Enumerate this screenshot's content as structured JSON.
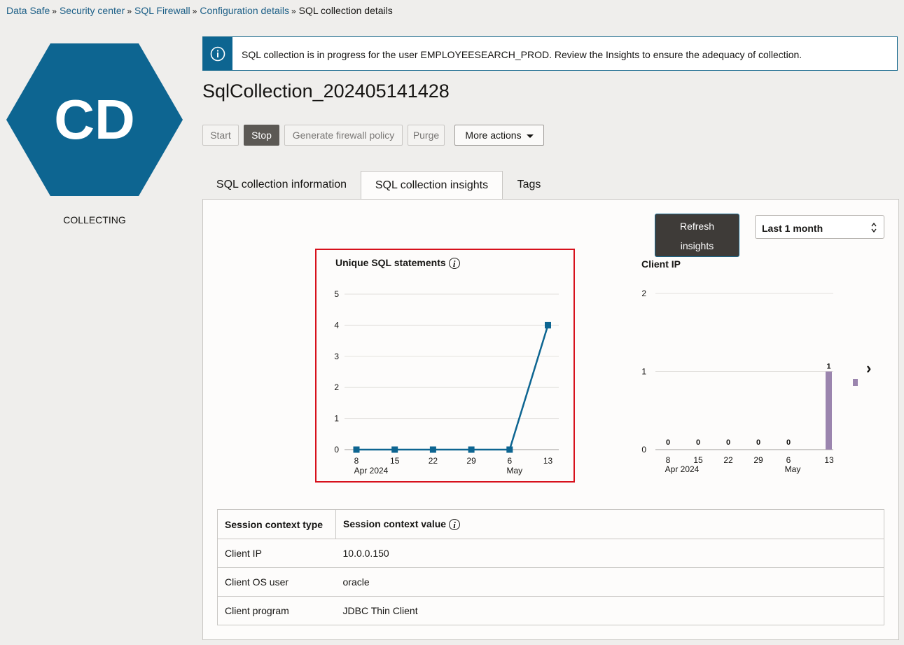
{
  "breadcrumb": {
    "items": [
      "Data Safe",
      "Security center",
      "SQL Firewall",
      "Configuration details"
    ],
    "separator": "»",
    "current": "SQL collection details"
  },
  "badge": {
    "initials": "CD",
    "status": "COLLECTING",
    "color": "#0d6591"
  },
  "banner": {
    "icon": "info-circle-icon",
    "message": "SQL collection is in progress for the user EMPLOYEESEARCH_PROD. Review the Insights to ensure the adequacy of collection."
  },
  "title": "SqlCollection_202405141428",
  "toolbar": {
    "start": "Start",
    "stop": "Stop",
    "generate": "Generate firewall policy",
    "purge": "Purge",
    "more": "More actions"
  },
  "tabs": [
    {
      "label": "SQL collection information",
      "selected": false
    },
    {
      "label": "SQL collection insights",
      "selected": true
    },
    {
      "label": "Tags",
      "selected": false
    }
  ],
  "insights": {
    "refresh_line1": "Refresh",
    "refresh_line2": "insights",
    "range": "Last 1 month"
  },
  "chart_data": [
    {
      "type": "line",
      "title": "Unique SQL statements",
      "x": [
        "8",
        "15",
        "22",
        "29",
        "6",
        "13"
      ],
      "x_sublabels": [
        "Apr 2024",
        "",
        "",
        "",
        "May",
        ""
      ],
      "series": [
        {
          "values": [
            0,
            0,
            0,
            0,
            0,
            4
          ],
          "color": "#0d6591"
        }
      ],
      "y_ticks": [
        "0",
        "1",
        "2",
        "3",
        "4",
        "5"
      ],
      "ylim": [
        0,
        5
      ],
      "grid": true
    },
    {
      "type": "bar",
      "title": "Client IP",
      "categories": [
        "8",
        "15",
        "22",
        "29",
        "6",
        "13"
      ],
      "category_sublabels": [
        "Apr 2024",
        "",
        "",
        "",
        "May",
        ""
      ],
      "values": [
        0,
        0,
        0,
        0,
        0,
        1
      ],
      "data_labels": [
        "0",
        "0",
        "0",
        "0",
        "0",
        "1"
      ],
      "y_ticks": [
        "0",
        "1",
        "2"
      ],
      "ylim": [
        0,
        2
      ],
      "color": "#9b85ae",
      "grid": true
    }
  ],
  "context_table": {
    "headers": [
      "Session context type",
      "Session context value"
    ],
    "rows": [
      [
        "Client IP",
        "10.0.0.150"
      ],
      [
        "Client OS user",
        "oracle"
      ],
      [
        "Client program",
        "JDBC Thin Client"
      ]
    ]
  }
}
